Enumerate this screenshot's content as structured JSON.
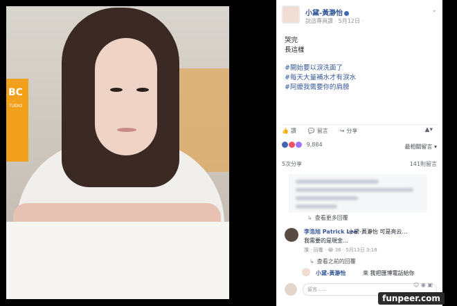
{
  "post": {
    "page_name": "小黛-黃瀞怡",
    "meta": "說這專頁讚 · 5月12日 ·",
    "lines": [
      "哭完",
      "長這樣"
    ],
    "hashtags": [
      "#開始要以淚洗面了",
      "#每天大量補水才有淚水",
      "#阿嬤我需要你的肩膀"
    ]
  },
  "actions": {
    "like": "讚",
    "comment": "留言",
    "share": "分享"
  },
  "reactions": {
    "count": "9,884",
    "sort": "最相關留言 ▾"
  },
  "stats": {
    "shares": "5次分享",
    "comments": "141則留言"
  },
  "comments": {
    "view_more": "查看更多回覆",
    "main": {
      "name": "李浩旭 Patrick Lee",
      "text_line1": "小黛-黃瀞怡 可是亮云…",
      "text_line2": "我需要的是現金…",
      "meta": "讚 · 回覆 · 😂 36 · 5月13日 3:18"
    },
    "view_previous": "查看之前的回覆",
    "reply": {
      "name": "小黛-黃瀞怡",
      "text": "來 我把匯博電話給你"
    },
    "compose_placeholder": "留言……"
  },
  "colors": {
    "link": "#365899",
    "like_blue": "#4267b2",
    "love_red": "#f25268",
    "care_purple": "#a173ff"
  },
  "watermark": "funpeer.com"
}
